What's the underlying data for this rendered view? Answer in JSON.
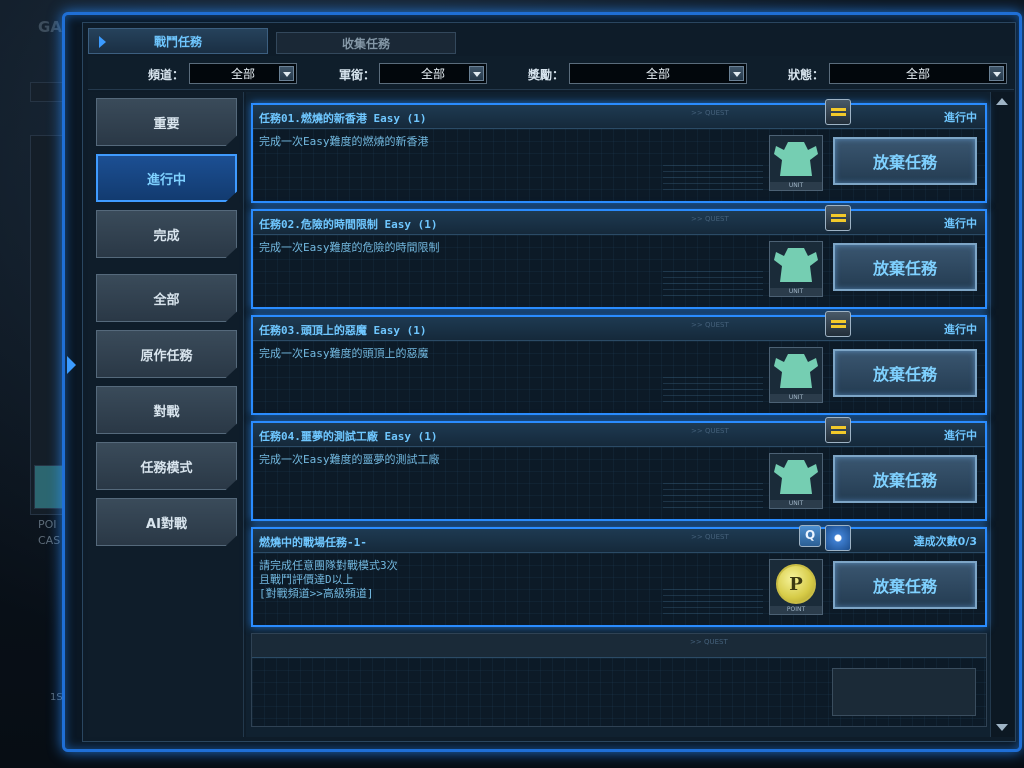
{
  "tabs": [
    {
      "label": "戰鬥任務",
      "active": true
    },
    {
      "label": "收集任務",
      "active": false
    }
  ],
  "filters": [
    {
      "label": "頻道：",
      "value": "全部"
    },
    {
      "label": "軍銜：",
      "value": "全部"
    },
    {
      "label": "獎勵：",
      "value": "全部"
    },
    {
      "label": "狀態：",
      "value": "全部"
    }
  ],
  "sidebar": {
    "items": [
      {
        "label": "重要",
        "active": false
      },
      {
        "label": "進行中",
        "active": true
      },
      {
        "label": "完成",
        "active": false
      },
      {
        "label": "全部",
        "active": false
      },
      {
        "label": "原作任務",
        "active": false
      },
      {
        "label": "對戰",
        "active": false
      },
      {
        "label": "任務模式",
        "active": false
      },
      {
        "label": "AI對戰",
        "active": false
      }
    ]
  },
  "quests": [
    {
      "title": "任務01.燃燒的新香港 Easy (1)",
      "status": "進行中",
      "description": "完成一次Easy難度的燃燒的新香港",
      "reward_caption": "UNIT",
      "action_label": "放棄任務",
      "icon": "rank-bars-icon"
    },
    {
      "title": "任務02.危險的時間限制 Easy (1)",
      "status": "進行中",
      "description": "完成一次Easy難度的危險的時間限制",
      "reward_caption": "UNIT",
      "action_label": "放棄任務",
      "icon": "rank-bars-icon"
    },
    {
      "title": "任務03.頭頂上的惡魔 Easy (1)",
      "status": "進行中",
      "description": "完成一次Easy難度的頭頂上的惡魔",
      "reward_caption": "UNIT",
      "action_label": "放棄任務",
      "icon": "rank-bars-icon"
    },
    {
      "title": "任務04.噩夢的測試工廠 Easy (1)",
      "status": "進行中",
      "description": "完成一次Easy難度的噩夢的測試工廠",
      "reward_caption": "UNIT",
      "action_label": "放棄任務",
      "icon": "rank-bars-icon"
    },
    {
      "title": "燃燒中的戰場任務-1-",
      "status": "達成次數0/3",
      "description_lines": [
        "請完成任意團隊對戰模式3次",
        "且戰鬥評價達D以上",
        "[對戰頻道>>高級頻道]"
      ],
      "reward_caption": "POINT",
      "reward_symbol": "P",
      "action_label": "放棄任務",
      "icons": [
        "quest-q-icon",
        "burst-icon"
      ]
    }
  ],
  "card_tag": ">> QUEST",
  "background": {
    "left_labels": [
      "POI",
      "CAS",
      "1S"
    ]
  },
  "colors": {
    "frame_glow": "#2a8cff",
    "title_text": "#6fc7ff",
    "rank_bars": "#f3c92a",
    "unit_icon": "#7fe0c0",
    "point_coin": "#e3dc63"
  }
}
